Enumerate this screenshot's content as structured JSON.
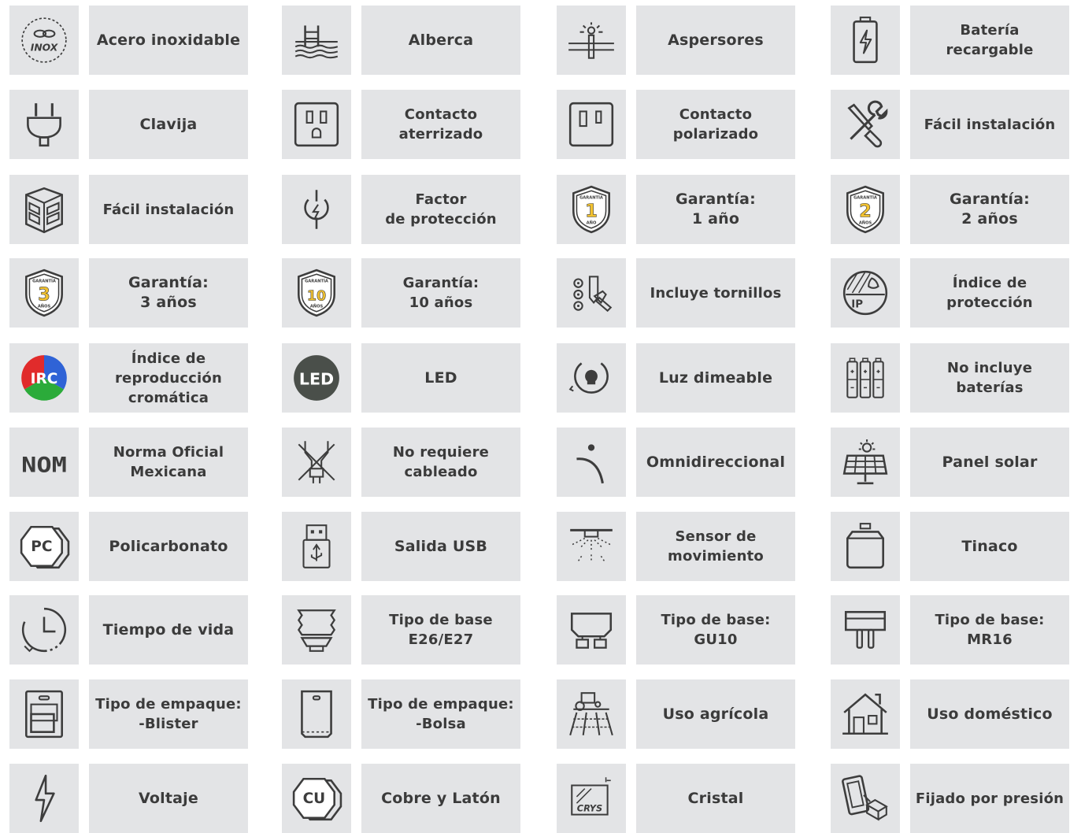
{
  "colors": {
    "tile_bg": "#e3e4e6",
    "icon_stroke": "#3d3d3d",
    "label_text": "#3b3b3b",
    "warranty_gold": "#f2c230",
    "led_badge": "#4a4f4a"
  },
  "items": [
    {
      "icon": "stainless-steel-inox-icon",
      "label": "Acero inoxidable",
      "icon_text": "INOX"
    },
    {
      "icon": "pool-icon",
      "label": "Alberca"
    },
    {
      "icon": "sprinkler-icon",
      "label": "Aspersores"
    },
    {
      "icon": "rechargeable-battery-icon",
      "label": "Batería\nrecargable"
    },
    {
      "icon": "plug-icon",
      "label": "Clavija"
    },
    {
      "icon": "grounded-outlet-icon",
      "label": "Contacto\naterrizado"
    },
    {
      "icon": "polarized-outlet-icon",
      "label": "Contacto\npolarizado"
    },
    {
      "icon": "tools-icon",
      "label": "Fácil instalación"
    },
    {
      "icon": "easy-install-box-icon",
      "label": "Fácil instalación"
    },
    {
      "icon": "power-factor-icon",
      "label": "Factor\nde protección"
    },
    {
      "icon": "warranty-1-year-icon",
      "label": "Garantía:\n1 año",
      "icon_text": "1",
      "icon_top": "GARANTÍA",
      "icon_bottom": "AÑO"
    },
    {
      "icon": "warranty-2-years-icon",
      "label": "Garantía:\n2 años",
      "icon_text": "2",
      "icon_top": "GARANTÍA",
      "icon_bottom": "AÑOS"
    },
    {
      "icon": "warranty-3-years-icon",
      "label": "Garantía:\n3 años",
      "icon_text": "3",
      "icon_top": "GARANTÍA",
      "icon_bottom": "AÑOS"
    },
    {
      "icon": "warranty-10-years-icon",
      "label": "Garantía:\n10 años",
      "icon_text": "10",
      "icon_top": "GARANTÍA",
      "icon_bottom": "AÑOS"
    },
    {
      "icon": "screws-icon",
      "label": "Incluye tornillos"
    },
    {
      "icon": "ip-protection-icon",
      "label": "Índice de\nprotección",
      "icon_text": "IP"
    },
    {
      "icon": "irc-color-rendering-icon",
      "label": "Índice de\nreproducción\ncromática",
      "icon_text": "IRC"
    },
    {
      "icon": "led-icon",
      "label": "LED",
      "icon_text": "LED"
    },
    {
      "icon": "dimmable-light-icon",
      "label": "Luz dimeable"
    },
    {
      "icon": "no-batteries-icon",
      "label": "No incluye\nbaterías"
    },
    {
      "icon": "nom-icon",
      "label": "Norma Oficial\nMexicana",
      "icon_text": "NOM"
    },
    {
      "icon": "no-wiring-icon",
      "label": "No requiere\ncableado"
    },
    {
      "icon": "omnidirectional-icon",
      "label": "Omnidireccional"
    },
    {
      "icon": "solar-panel-icon",
      "label": "Panel solar"
    },
    {
      "icon": "polycarbonate-icon",
      "label": "Policarbonato",
      "icon_text": "PC"
    },
    {
      "icon": "usb-output-icon",
      "label": "Salida USB"
    },
    {
      "icon": "motion-sensor-icon",
      "label": "Sensor de\nmovimiento"
    },
    {
      "icon": "water-tank-icon",
      "label": "Tinaco"
    },
    {
      "icon": "clock-lifetime-icon",
      "label": "Tiempo de vida"
    },
    {
      "icon": "e26-e27-base-icon",
      "label": "Tipo de base\nE26/E27"
    },
    {
      "icon": "gu10-base-icon",
      "label": "Tipo de base:\nGU10"
    },
    {
      "icon": "mr16-base-icon",
      "label": "Tipo de base:\nMR16"
    },
    {
      "icon": "blister-package-icon",
      "label": "Tipo de empaque:\n-Blister"
    },
    {
      "icon": "bag-package-icon",
      "label": "Tipo de empaque:\n-Bolsa"
    },
    {
      "icon": "agricultural-tractor-icon",
      "label": "Uso agrícola"
    },
    {
      "icon": "house-icon",
      "label": "Uso doméstico"
    },
    {
      "icon": "voltage-lightning-icon",
      "label": "Voltaje"
    },
    {
      "icon": "copper-brass-cu-icon",
      "label": "Cobre y Latón",
      "icon_text": "CU"
    },
    {
      "icon": "crystal-glass-icon",
      "label": "Cristal",
      "icon_text": "CRYS"
    },
    {
      "icon": "press-fit-icon",
      "label": "Fijado por presión"
    }
  ]
}
